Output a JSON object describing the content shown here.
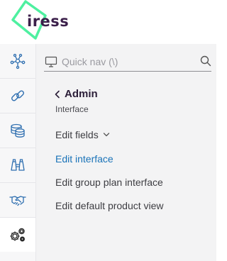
{
  "brand": {
    "logo_text": "iress",
    "accent": "#4ef0a0",
    "text_color": "#3b1f4a"
  },
  "rail": {
    "items": [
      {
        "icon": "network-icon"
      },
      {
        "icon": "link-icon"
      },
      {
        "icon": "database-icon"
      },
      {
        "icon": "binoculars-icon"
      },
      {
        "icon": "handshake-icon"
      },
      {
        "icon": "settings-gears-icon",
        "active": true
      }
    ]
  },
  "quicknav": {
    "placeholder": "Quick nav (\\)"
  },
  "section": {
    "back_title": "Admin",
    "subtitle": "Interface"
  },
  "menu": {
    "items": [
      {
        "label": "Edit fields",
        "expandable": true
      },
      {
        "label": "Edit interface",
        "selected": true
      },
      {
        "label": "Edit group plan interface"
      },
      {
        "label": "Edit default product view"
      }
    ]
  },
  "colors": {
    "link_blue": "#1a73b8",
    "rail_icon": "#2f6fb0",
    "background": "#f3f3f4"
  }
}
